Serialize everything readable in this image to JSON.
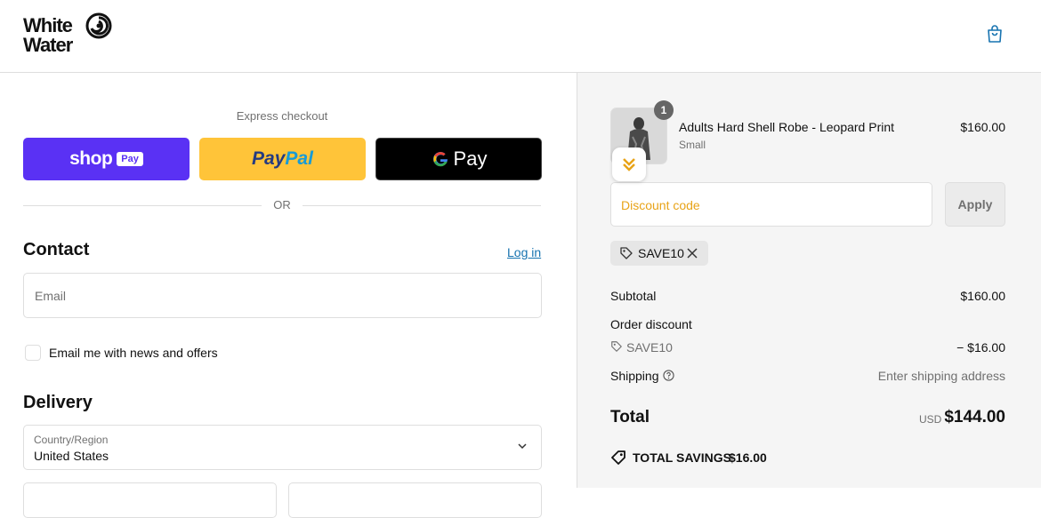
{
  "brand": {
    "line1": "White",
    "line2": "Water"
  },
  "colors": {
    "accent_link": "#1773b0",
    "shop_pay": "#5a31f4",
    "paypal": "#ffc439",
    "discount_placeholder": "#e8a317"
  },
  "express": {
    "label": "Express checkout",
    "shop_pay": {
      "text": "shop",
      "badge": "Pay"
    },
    "paypal": {
      "part1": "Pay",
      "part2": "Pal"
    },
    "gpay": {
      "text": "Pay"
    },
    "or": "OR"
  },
  "contact": {
    "title": "Contact",
    "login_label": "Log in",
    "email_placeholder": "Email",
    "newsletter_label": "Email me with news and offers"
  },
  "delivery": {
    "title": "Delivery",
    "country_label": "Country/Region",
    "country_value": "United States"
  },
  "cart": {
    "item": {
      "quantity": "1",
      "name": "Adults Hard Shell Robe - Leopard Print",
      "variant": "Small",
      "price": "$160.00"
    },
    "discount_placeholder": "Discount code",
    "apply_label": "Apply",
    "applied_code": "SAVE10"
  },
  "summary": {
    "subtotal_label": "Subtotal",
    "subtotal_value": "$160.00",
    "order_discount_label": "Order discount",
    "discount_code": "SAVE10",
    "discount_value": "− $16.00",
    "shipping_label": "Shipping",
    "shipping_value": "Enter shipping address",
    "total_label": "Total",
    "currency": "USD",
    "total_value": "$144.00",
    "savings_label": "TOTAL SAVINGS",
    "savings_value": "$16.00"
  }
}
